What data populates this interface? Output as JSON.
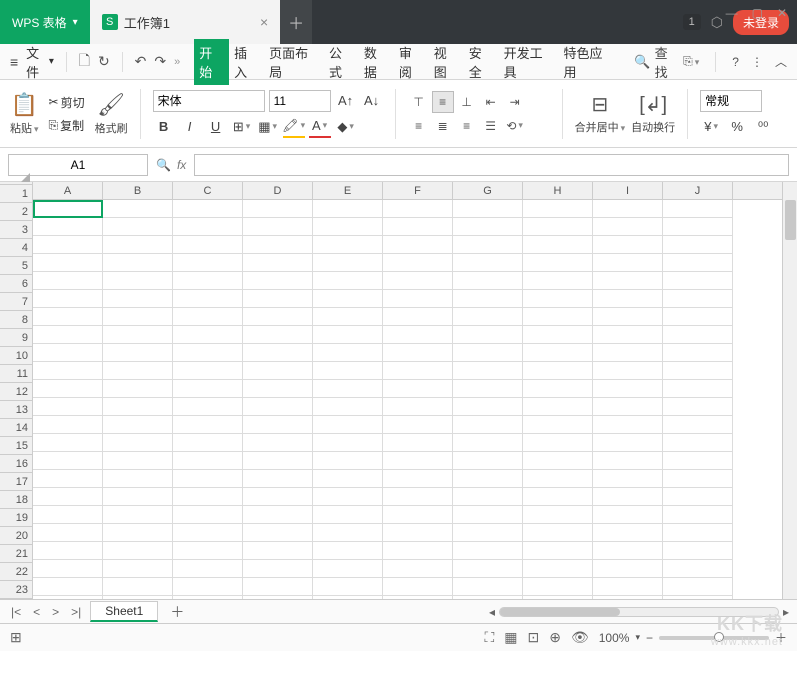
{
  "titlebar": {
    "app_name": "WPS 表格",
    "doc_name": "工作簿1",
    "doc_icon_letter": "S",
    "badge": "1",
    "login": "未登录"
  },
  "menu": {
    "file": "文件",
    "tabs": [
      "开始",
      "插入",
      "页面布局",
      "公式",
      "数据",
      "审阅",
      "视图",
      "安全",
      "开发工具",
      "特色应用"
    ],
    "search": "查找"
  },
  "toolbar": {
    "paste": "粘贴",
    "cut": "剪切",
    "copy": "复制",
    "format_painter": "格式刷",
    "font_name": "宋体",
    "font_size": "11",
    "merge_center": "合并居中",
    "wrap_text": "自动换行",
    "number_format": "常规"
  },
  "formula": {
    "namebox": "A1",
    "fx_value": ""
  },
  "grid": {
    "columns": [
      "A",
      "B",
      "C",
      "D",
      "E",
      "F",
      "G",
      "H",
      "I",
      "J"
    ],
    "rows": [
      "1",
      "2",
      "3",
      "4",
      "5",
      "6",
      "7",
      "8",
      "9",
      "10",
      "11",
      "12",
      "13",
      "14",
      "15",
      "16",
      "17",
      "18",
      "19",
      "20",
      "21",
      "22",
      "23"
    ]
  },
  "sheet": {
    "active": "Sheet1"
  },
  "status": {
    "zoom": "100%"
  },
  "watermark": {
    "main": "KK下载",
    "sub": "www.kkx.net"
  }
}
